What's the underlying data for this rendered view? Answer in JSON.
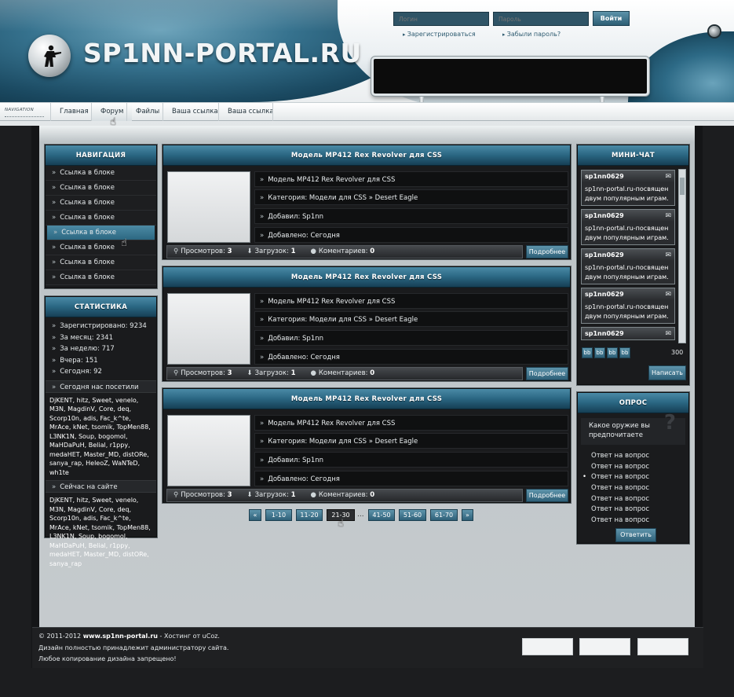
{
  "site": {
    "logo_text": "SP1NN-PORTAL.RU"
  },
  "login": {
    "user_placeholder": "Логин",
    "pass_placeholder": "Пароль",
    "submit_label": "Войти",
    "register_link": "Зарегистрироваться",
    "forgot_link": "Забыли пароль?"
  },
  "topnav": {
    "badge": "Navigation",
    "items": [
      {
        "label": "Главная"
      },
      {
        "label": "Форум"
      },
      {
        "label": "Файлы"
      },
      {
        "label": "Ваша ссылка"
      },
      {
        "label": "Ваша ссылка"
      }
    ],
    "active_index": 1
  },
  "nav_block": {
    "title": "НАВИГАЦИЯ",
    "items": [
      "Ссылка в блоке",
      "Ссылка в блоке",
      "Ссылка в блоке",
      "Ссылка в блоке",
      "Ссылка в блоке",
      "Ссылка в блоке",
      "Ссылка в блоке",
      "Ссылка в блоке"
    ],
    "active_index": 4
  },
  "stats_block": {
    "title": "СТАТИСТИКА",
    "rows": [
      "Зарегистрировано: 9234",
      "За месяц: 2341",
      "За неделю: 717",
      "Вчера: 151",
      "Сегодня: 92"
    ],
    "today_label": "Сегодня нас посетили",
    "today_users": "DjKENT, hitz, Sweet, venelo, M3N, MagdinV, Core, deq, Scorp10n, adis, Fac_k^te, MrAce, kNet, tsomik, TopMen88, L3NK1N, Soup, bogomol, MaHDaPuH, Belial, r1ppy, medaHET, Master_MD, distORe, sanya_rap, HeleoZ, WaNTeD, wh1te",
    "online_label": "Сейчас на сайте",
    "online_users": "DjKENT, hitz, Sweet, venelo, M3N, MagdinV, Core, deq, Scorp10n, adis, Fac_k^te, MrAce, kNet, tsomik, TopMen88, L3NK1N, Soup, bogomol, MaHDaPuH, Belial, r1ppy, medaHET, Master_MD, distORe, sanya_rap"
  },
  "articles": [
    {
      "title": "Модель MP412 Rex Revolver для CSS",
      "line1": "Модель MP412 Rex Revolver для CSS",
      "line2": "Категория: Модели для CSS » Desert Eagle",
      "line3": "Добавил: Sp1nn",
      "line4": "Добавлено: Сегодня",
      "views_label": "Просмотров:",
      "views": "3",
      "downloads_label": "Загрузок:",
      "downloads": "1",
      "comments_label": "Коментариев:",
      "comments": "0",
      "more_label": "Подробнее"
    },
    {
      "title": "Модель MP412 Rex Revolver для CSS",
      "line1": "Модель MP412 Rex Revolver для CSS",
      "line2": "Категория: Модели для CSS » Desert Eagle",
      "line3": "Добавил: Sp1nn",
      "line4": "Добавлено: Сегодня",
      "views_label": "Просмотров:",
      "views": "3",
      "downloads_label": "Загрузок:",
      "downloads": "1",
      "comments_label": "Коментариев:",
      "comments": "0",
      "more_label": "Подробнее"
    },
    {
      "title": "Модель MP412 Rex Revolver для CSS",
      "line1": "Модель MP412 Rex Revolver для CSS",
      "line2": "Категория: Модели для CSS » Desert Eagle",
      "line3": "Добавил: Sp1nn",
      "line4": "Добавлено: Сегодня",
      "views_label": "Просмотров:",
      "views": "3",
      "downloads_label": "Загрузок:",
      "downloads": "1",
      "comments_label": "Коментариев:",
      "comments": "0",
      "more_label": "Подробнее"
    }
  ],
  "pagination": {
    "prev": "«",
    "pages": [
      "1-10",
      "11-20",
      "21-30",
      "41-50",
      "51-60",
      "61-70"
    ],
    "active_index": 2,
    "ellipsis": "...",
    "next": "»"
  },
  "chat_block": {
    "title": "МИНИ-ЧАТ",
    "messages": [
      {
        "user": "sp1nn0629",
        "text": "sp1nn-portal.ru-посвящен двум популярным играм."
      },
      {
        "user": "sp1nn0629",
        "text": "sp1nn-portal.ru-посвящен двум популярным играм."
      },
      {
        "user": "sp1nn0629",
        "text": "sp1nn-portal.ru-посвящен двум популярным играм."
      },
      {
        "user": "sp1nn0629",
        "text": "sp1nn-portal.ru-посвящен двум популярным играм."
      },
      {
        "user": "sp1nn0629",
        "text": ""
      }
    ],
    "bb_buttons": [
      "bb",
      "bb",
      "bb",
      "bb"
    ],
    "char_count": "300",
    "send_label": "Написать"
  },
  "poll_block": {
    "title": "ОПРОС",
    "question": "Какое оружие вы предпочитаете",
    "options": [
      "Ответ на вопрос",
      "Ответ на вопрос",
      "Ответ на вопрос",
      "Ответ на вопрос",
      "Ответ на вопрос",
      "Ответ на вопрос",
      "Ответ на вопрос"
    ],
    "selected_index": 2,
    "submit_label": "Ответить"
  },
  "footer": {
    "copy_prefix": "© 2011-2012",
    "site": "www.sp1nn-portal.ru",
    "copy_suffix": "- Хостинг от uCoz.",
    "line2": "Дизайн полностью принадлежит администратору сайта.",
    "line3": "Любое копирование дизайна запрещено!"
  },
  "colors": {
    "accent": "#2e6a86",
    "panel_bg": "#1a1b1d",
    "page_bg": "#c3c8cb"
  }
}
